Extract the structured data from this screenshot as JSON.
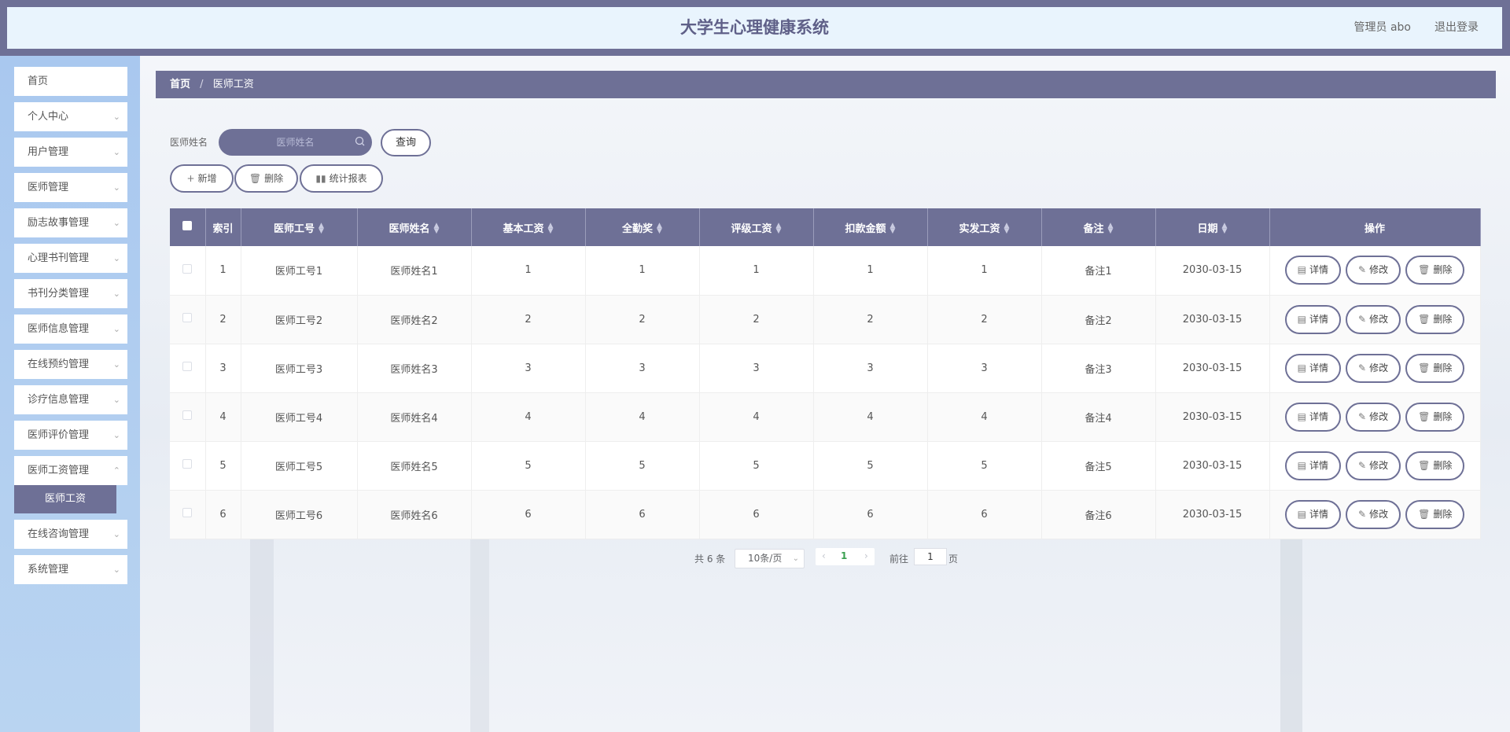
{
  "header": {
    "title": "大学生心理健康系统",
    "user": "管理员 abo",
    "logout": "退出登录"
  },
  "sidebar": {
    "items": [
      {
        "label": "首页",
        "expandable": false
      },
      {
        "label": "个人中心",
        "expandable": true
      },
      {
        "label": "用户管理",
        "expandable": true
      },
      {
        "label": "医师管理",
        "expandable": true
      },
      {
        "label": "励志故事管理",
        "expandable": true
      },
      {
        "label": "心理书刊管理",
        "expandable": true
      },
      {
        "label": "书刊分类管理",
        "expandable": true
      },
      {
        "label": "医师信息管理",
        "expandable": true
      },
      {
        "label": "在线预约管理",
        "expandable": true
      },
      {
        "label": "诊疗信息管理",
        "expandable": true
      },
      {
        "label": "医师评价管理",
        "expandable": true
      },
      {
        "label": "医师工资管理",
        "expandable": true
      },
      {
        "label": "在线咨询管理",
        "expandable": true
      },
      {
        "label": "系统管理",
        "expandable": true
      }
    ],
    "active_sub": "医师工资"
  },
  "breadcrumb": {
    "home": "首页",
    "separator": "/",
    "current": "医师工资"
  },
  "search": {
    "label": "医师姓名",
    "placeholder": "医师姓名",
    "button": "查询"
  },
  "toolbar": {
    "add": "新增",
    "delete": "删除",
    "report": "统计报表"
  },
  "table": {
    "columns": [
      "索引",
      "医师工号",
      "医师姓名",
      "基本工资",
      "全勤奖",
      "评级工资",
      "扣款金额",
      "实发工资",
      "备注",
      "日期",
      "操作"
    ],
    "rows": [
      {
        "index": "1",
        "id": "医师工号1",
        "name": "医师姓名1",
        "base": "1",
        "attendance": "1",
        "grade": "1",
        "deduction": "1",
        "actual": "1",
        "note": "备注1",
        "date": "2030-03-15"
      },
      {
        "index": "2",
        "id": "医师工号2",
        "name": "医师姓名2",
        "base": "2",
        "attendance": "2",
        "grade": "2",
        "deduction": "2",
        "actual": "2",
        "note": "备注2",
        "date": "2030-03-15"
      },
      {
        "index": "3",
        "id": "医师工号3",
        "name": "医师姓名3",
        "base": "3",
        "attendance": "3",
        "grade": "3",
        "deduction": "3",
        "actual": "3",
        "note": "备注3",
        "date": "2030-03-15"
      },
      {
        "index": "4",
        "id": "医师工号4",
        "name": "医师姓名4",
        "base": "4",
        "attendance": "4",
        "grade": "4",
        "deduction": "4",
        "actual": "4",
        "note": "备注4",
        "date": "2030-03-15"
      },
      {
        "index": "5",
        "id": "医师工号5",
        "name": "医师姓名5",
        "base": "5",
        "attendance": "5",
        "grade": "5",
        "deduction": "5",
        "actual": "5",
        "note": "备注5",
        "date": "2030-03-15"
      },
      {
        "index": "6",
        "id": "医师工号6",
        "name": "医师姓名6",
        "base": "6",
        "attendance": "6",
        "grade": "6",
        "deduction": "6",
        "actual": "6",
        "note": "备注6",
        "date": "2030-03-15"
      }
    ],
    "actions": {
      "detail": "详情",
      "edit": "修改",
      "delete": "删除"
    }
  },
  "pagination": {
    "total": "共 6 条",
    "page_size": "10条/页",
    "current_page": "1",
    "goto_label": "前往",
    "goto_value": "1",
    "page_suffix": "页"
  },
  "colors": {
    "accent": "#6e7096",
    "header_bg": "#e9f4fd",
    "sidebar_bg": "#a9c8ef",
    "highlight_green": "#3aa050"
  }
}
